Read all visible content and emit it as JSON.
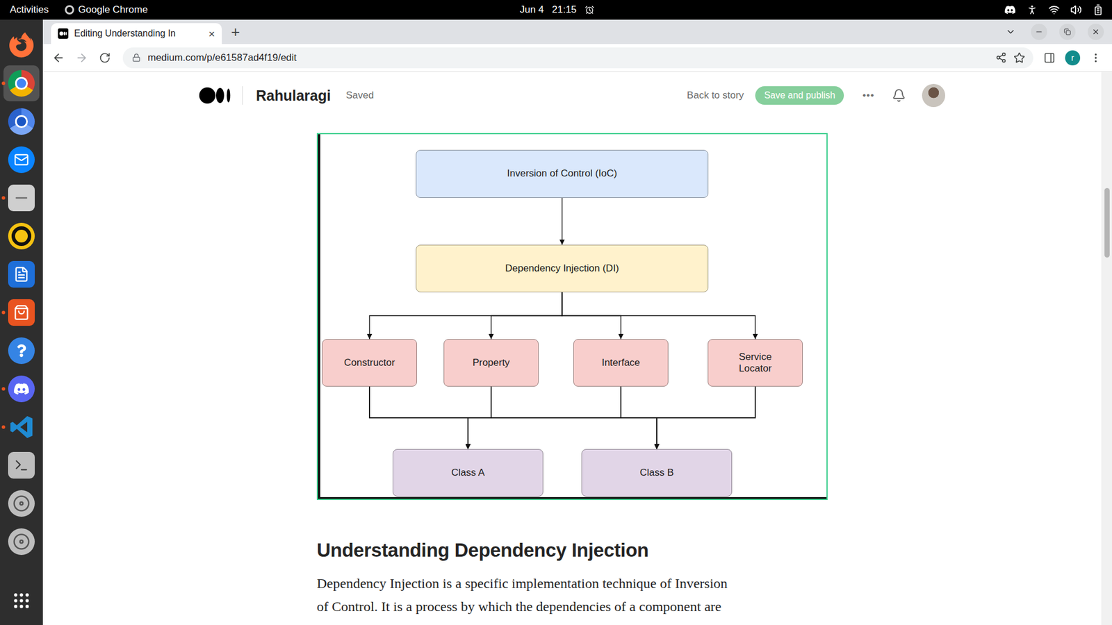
{
  "top_bar": {
    "activities": "Activities",
    "app": "Google Chrome",
    "date": "Jun 4",
    "time": "21:15"
  },
  "dock": {
    "items": [
      {
        "kind": "firefox",
        "running": false,
        "selected": false
      },
      {
        "kind": "chrome",
        "running": true,
        "selected": true
      },
      {
        "kind": "chromium",
        "running": false,
        "selected": false
      },
      {
        "kind": "thunderbird",
        "running": false,
        "selected": false
      },
      {
        "kind": "files",
        "running": true,
        "selected": false
      },
      {
        "kind": "rhythmbox",
        "running": false,
        "selected": false
      },
      {
        "kind": "writer",
        "running": false,
        "selected": false
      },
      {
        "kind": "appstore",
        "running": true,
        "selected": false
      },
      {
        "kind": "help",
        "running": false,
        "selected": false
      },
      {
        "kind": "discord",
        "running": true,
        "selected": false
      },
      {
        "kind": "vscode",
        "running": true,
        "selected": false
      },
      {
        "kind": "terminal",
        "running": false,
        "selected": false
      },
      {
        "kind": "disk",
        "running": false,
        "selected": false
      },
      {
        "kind": "disk",
        "running": false,
        "selected": false
      },
      {
        "kind": "apps",
        "running": false,
        "selected": false
      }
    ]
  },
  "browser": {
    "tabs": [
      {
        "title": "Editing Understanding In",
        "close": "×",
        "selected": true
      }
    ],
    "new_tab": "+",
    "url": "medium.com/p/e61587ad4f19/edit",
    "profile": "r"
  },
  "editor_header": {
    "author": "Rahularagi",
    "status": "Saved",
    "back": "Back to story",
    "publish": {
      "label": "Save and publish",
      "disabled": true
    },
    "more": "•••"
  },
  "diagram": {
    "nodes": [
      {
        "label": "Inversion of Control (IoC)",
        "color": "#dae8fc"
      },
      {
        "label": "Dependency Injection (DI)",
        "color": "#fff2cc"
      },
      {
        "label": "Constructor",
        "color": "#f8cecc"
      },
      {
        "label": "Property",
        "color": "#f8cecc"
      },
      {
        "label": "Interface",
        "color": "#f8cecc"
      },
      {
        "label": "Service Locator",
        "color": "#f8cecc"
      },
      {
        "label": "Class A",
        "color": "#e1d5e7"
      },
      {
        "label": "Class B",
        "color": "#e1d5e7"
      }
    ],
    "edges": [
      [
        "Inversion of Control (IoC)",
        "Dependency Injection (DI)"
      ],
      [
        "Dependency Injection (DI)",
        "Constructor"
      ],
      [
        "Dependency Injection (DI)",
        "Property"
      ],
      [
        "Dependency Injection (DI)",
        "Interface"
      ],
      [
        "Dependency Injection (DI)",
        "Service Locator"
      ],
      [
        "Constructor",
        "Class A"
      ],
      [
        "Property",
        "Class A"
      ],
      [
        "Interface",
        "Class A"
      ],
      [
        "Service Locator",
        "Class A"
      ],
      [
        "Constructor",
        "Class B"
      ],
      [
        "Property",
        "Class B"
      ],
      [
        "Interface",
        "Class B"
      ],
      [
        "Service Locator",
        "Class B"
      ]
    ]
  },
  "article": {
    "heading": "Understanding Dependency Injection",
    "lines": [
      "Dependency Injection is a specific implementation technique of Inversion",
      "of Control. It is a process by which the dependencies of a component are"
    ]
  },
  "scrollbar": {
    "level": 0.24
  }
}
